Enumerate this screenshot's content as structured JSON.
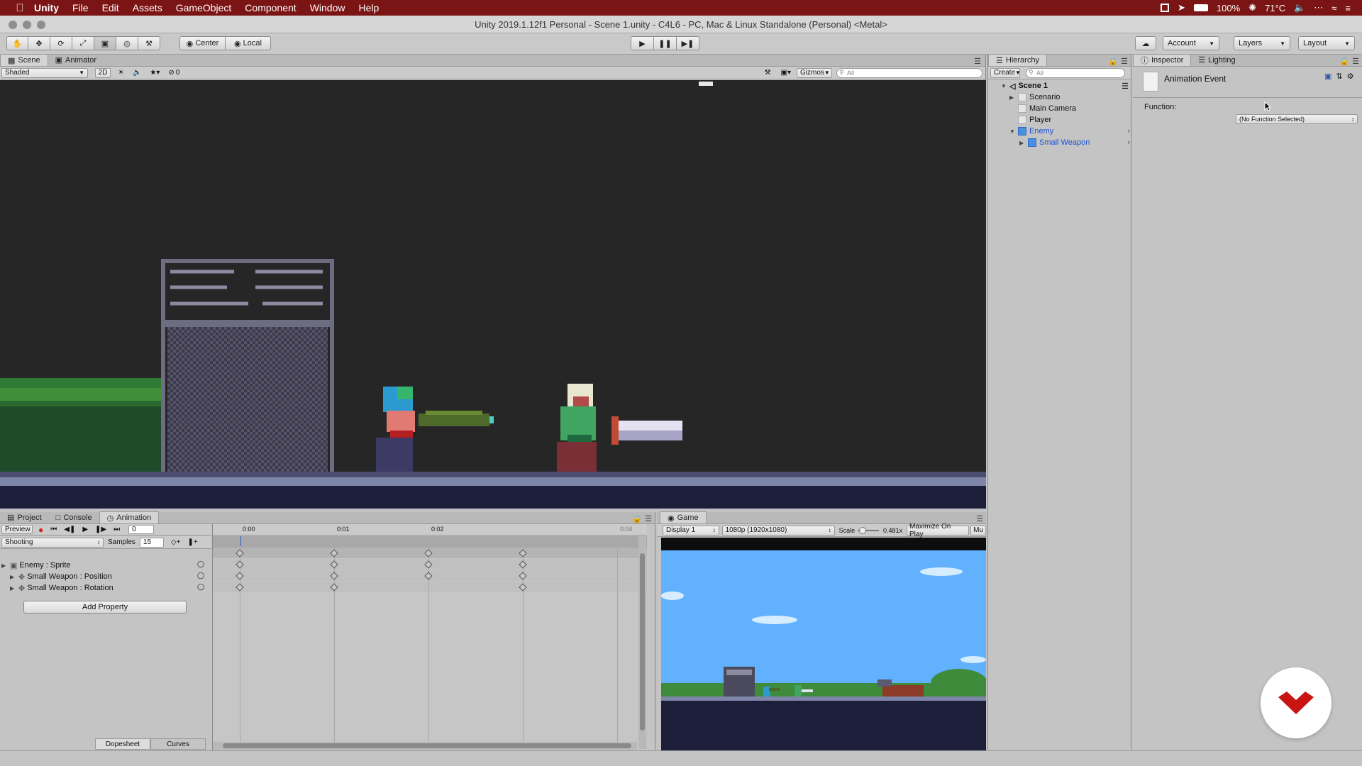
{
  "menubar": {
    "app": "Unity",
    "items": [
      "File",
      "Edit",
      "Assets",
      "GameObject",
      "Component",
      "Window",
      "Help"
    ],
    "battery": "100%",
    "temperature": "71°C"
  },
  "window": {
    "title": "Unity 2019.1.12f1 Personal - Scene 1.unity - C4L6 - PC, Mac & Linux Standalone (Personal) <Metal>"
  },
  "toolbar": {
    "pivot": "Center",
    "space": "Local",
    "account": "Account",
    "layers": "Layers",
    "layout": "Layout"
  },
  "scene": {
    "tabs": [
      "Scene",
      "Animator"
    ],
    "shading": "Shaded",
    "mode2d": "2D",
    "hidden_count": "0",
    "gizmos": "Gizmos",
    "search_placeholder": "All"
  },
  "hierarchy": {
    "tab": "Hierarchy",
    "create": "Create",
    "search_placeholder": "All",
    "scene_name": "Scene 1",
    "items": [
      {
        "label": "Scenario",
        "selected": false
      },
      {
        "label": "Main Camera",
        "selected": false
      },
      {
        "label": "Player",
        "selected": false
      },
      {
        "label": "Enemy",
        "selected": true
      },
      {
        "label": "Small Weapon",
        "selected": true
      }
    ]
  },
  "inspector": {
    "tabs": [
      "Inspector",
      "Lighting"
    ],
    "component_title": "Animation Event",
    "function_label": "Function:",
    "function_value": "(No Function Selected)"
  },
  "animation": {
    "tabs": [
      "Project",
      "Console",
      "Animation"
    ],
    "preview": "Preview",
    "frame": "0",
    "clip": "Shooting",
    "samples_label": "Samples",
    "samples": "15",
    "time_labels": [
      "0:00",
      "0:01",
      "0:02",
      "0:04"
    ],
    "properties": [
      "Enemy : Sprite",
      "Small Weapon : Position",
      "Small Weapon : Rotation"
    ],
    "add_property": "Add Property",
    "bottom_tabs": [
      "Dopesheet",
      "Curves"
    ]
  },
  "game": {
    "tab": "Game",
    "display": "Display 1",
    "resolution": "1080p (1920x1080)",
    "scale_label": "Scale",
    "scale_value": "0.481x",
    "maximize": "Maximize On Play",
    "mute": "Mu"
  },
  "colors": {
    "menubar": "#7b1414",
    "scene_bg": "#262626",
    "sky": "#62b1ff",
    "selected_blue": "#1a4fd6",
    "logo_red": "#c91414",
    "record_red": "#d42020"
  }
}
